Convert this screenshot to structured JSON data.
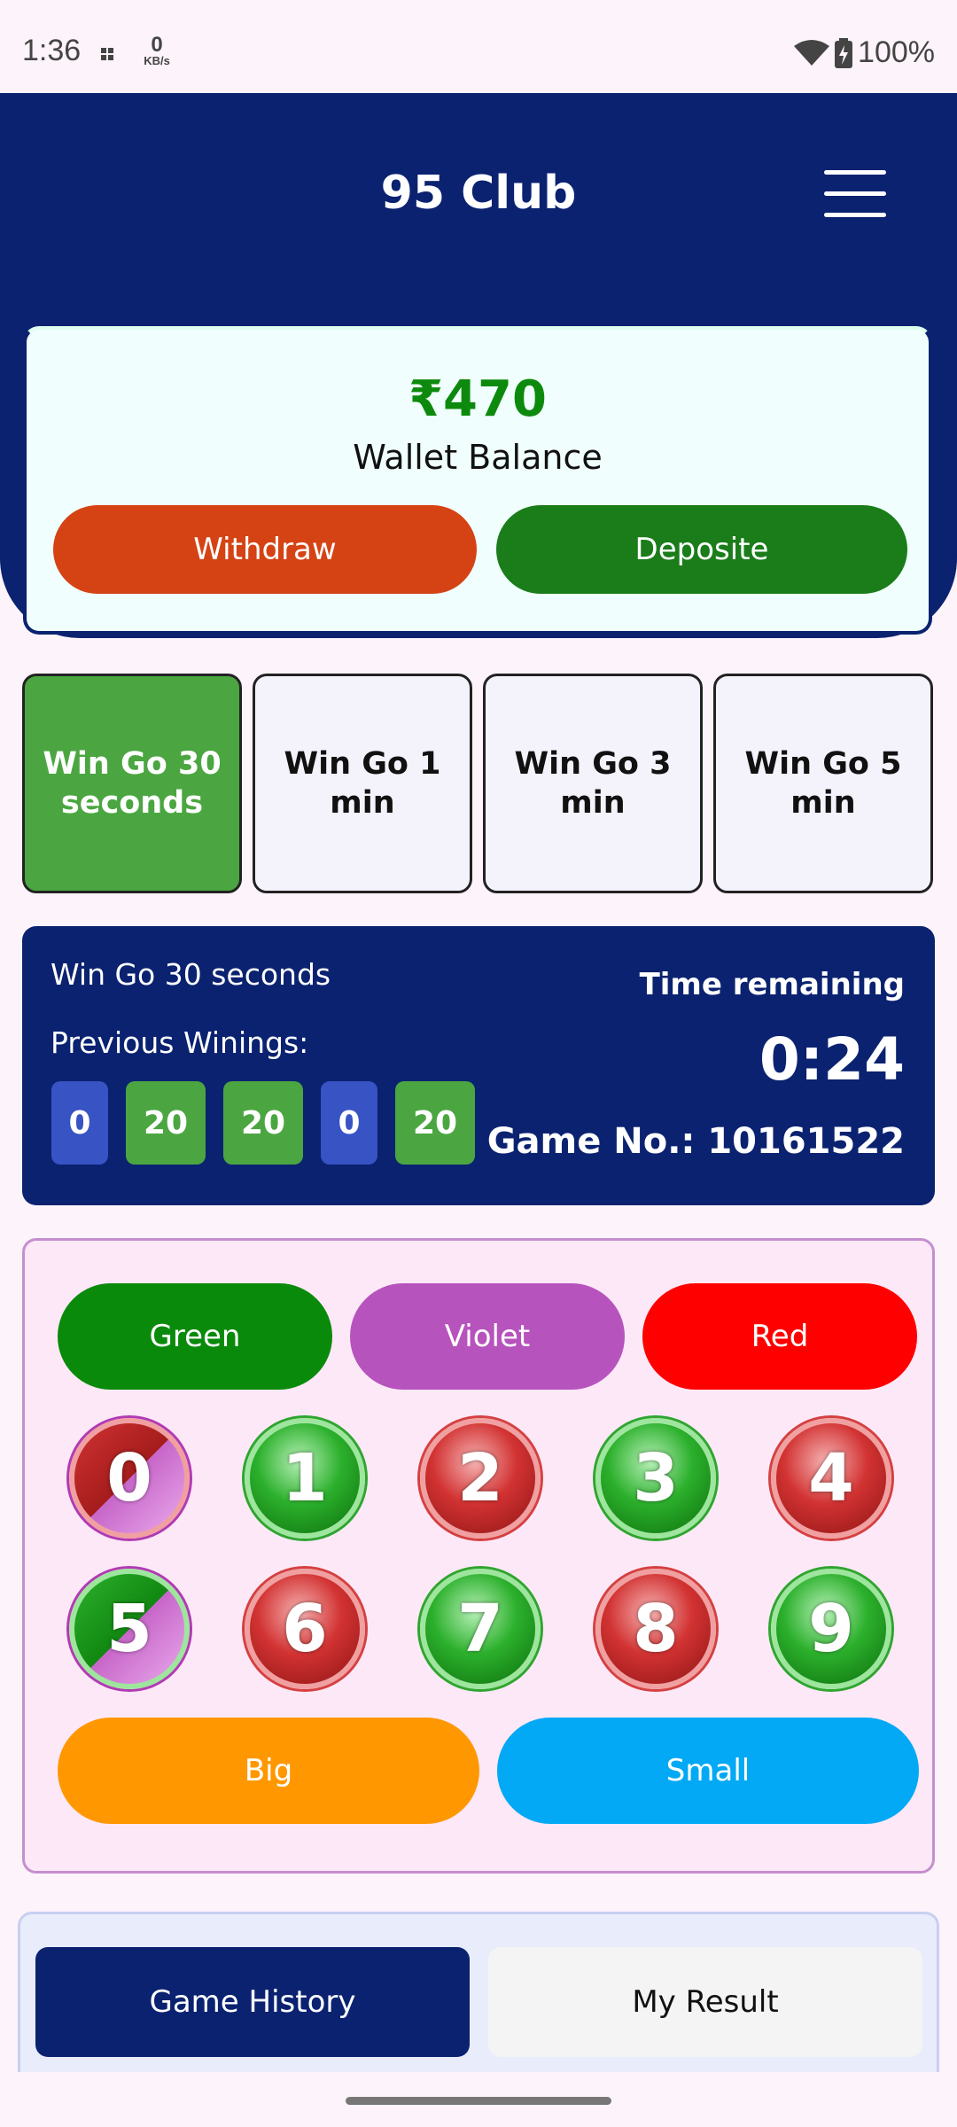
{
  "status_bar": {
    "time": "1:36",
    "net_speed": "0",
    "net_unit": "KB/s",
    "battery": "100%"
  },
  "header": {
    "title": "95 Club",
    "menu_icon": "hamburger-menu-icon"
  },
  "wallet": {
    "amount": "₹470",
    "label": "Wallet Balance",
    "withdraw_label": "Withdraw",
    "deposit_label": "Deposite"
  },
  "game_tabs": [
    {
      "label": "Win Go 30 seconds",
      "active": true
    },
    {
      "label": "Win Go 1 min",
      "active": false
    },
    {
      "label": "Win Go 3 min",
      "active": false
    },
    {
      "label": "Win Go 5 min",
      "active": false
    }
  ],
  "info": {
    "mode": "Win Go 30 seconds",
    "previous_label": "Previous Winings:",
    "previous": [
      {
        "value": "0",
        "color": "blue"
      },
      {
        "value": "20",
        "color": "green"
      },
      {
        "value": "20",
        "color": "green"
      },
      {
        "value": "0",
        "color": "blue"
      },
      {
        "value": "20",
        "color": "green"
      }
    ],
    "time_label": "Time remaining",
    "timer": "0:24",
    "game_no": "Game No.: 10161522"
  },
  "bet": {
    "colors": {
      "green": "Green",
      "violet": "Violet",
      "red": "Red"
    },
    "numbers": [
      "0",
      "1",
      "2",
      "3",
      "4",
      "5",
      "6",
      "7",
      "8",
      "9"
    ],
    "big": "Big",
    "small": "Small"
  },
  "history": {
    "game_history": "Game History",
    "my_result": "My Result"
  },
  "theme": {
    "navy": "#0b2270",
    "green": "#4ba641",
    "red": "#ff0000",
    "violet": "#b753bd",
    "orange": "#ff9800",
    "blue": "#03a9f4"
  }
}
